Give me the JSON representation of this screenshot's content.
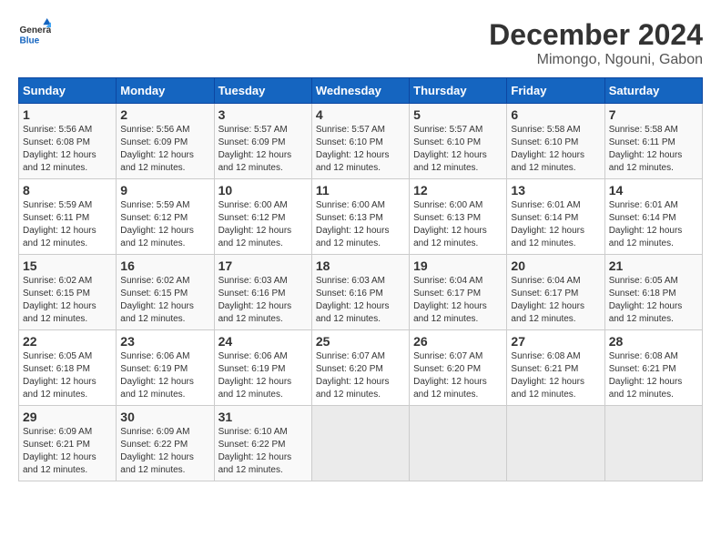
{
  "header": {
    "logo_line1": "General",
    "logo_line2": "Blue",
    "title": "December 2024",
    "subtitle": "Mimongo, Ngouni, Gabon"
  },
  "weekdays": [
    "Sunday",
    "Monday",
    "Tuesday",
    "Wednesday",
    "Thursday",
    "Friday",
    "Saturday"
  ],
  "weeks": [
    [
      {
        "day": "1",
        "info": "Sunrise: 5:56 AM\nSunset: 6:08 PM\nDaylight: 12 hours\nand 12 minutes."
      },
      {
        "day": "2",
        "info": "Sunrise: 5:56 AM\nSunset: 6:09 PM\nDaylight: 12 hours\nand 12 minutes."
      },
      {
        "day": "3",
        "info": "Sunrise: 5:57 AM\nSunset: 6:09 PM\nDaylight: 12 hours\nand 12 minutes."
      },
      {
        "day": "4",
        "info": "Sunrise: 5:57 AM\nSunset: 6:10 PM\nDaylight: 12 hours\nand 12 minutes."
      },
      {
        "day": "5",
        "info": "Sunrise: 5:57 AM\nSunset: 6:10 PM\nDaylight: 12 hours\nand 12 minutes."
      },
      {
        "day": "6",
        "info": "Sunrise: 5:58 AM\nSunset: 6:10 PM\nDaylight: 12 hours\nand 12 minutes."
      },
      {
        "day": "7",
        "info": "Sunrise: 5:58 AM\nSunset: 6:11 PM\nDaylight: 12 hours\nand 12 minutes."
      }
    ],
    [
      {
        "day": "8",
        "info": "Sunrise: 5:59 AM\nSunset: 6:11 PM\nDaylight: 12 hours\nand 12 minutes."
      },
      {
        "day": "9",
        "info": "Sunrise: 5:59 AM\nSunset: 6:12 PM\nDaylight: 12 hours\nand 12 minutes."
      },
      {
        "day": "10",
        "info": "Sunrise: 6:00 AM\nSunset: 6:12 PM\nDaylight: 12 hours\nand 12 minutes."
      },
      {
        "day": "11",
        "info": "Sunrise: 6:00 AM\nSunset: 6:13 PM\nDaylight: 12 hours\nand 12 minutes."
      },
      {
        "day": "12",
        "info": "Sunrise: 6:00 AM\nSunset: 6:13 PM\nDaylight: 12 hours\nand 12 minutes."
      },
      {
        "day": "13",
        "info": "Sunrise: 6:01 AM\nSunset: 6:14 PM\nDaylight: 12 hours\nand 12 minutes."
      },
      {
        "day": "14",
        "info": "Sunrise: 6:01 AM\nSunset: 6:14 PM\nDaylight: 12 hours\nand 12 minutes."
      }
    ],
    [
      {
        "day": "15",
        "info": "Sunrise: 6:02 AM\nSunset: 6:15 PM\nDaylight: 12 hours\nand 12 minutes."
      },
      {
        "day": "16",
        "info": "Sunrise: 6:02 AM\nSunset: 6:15 PM\nDaylight: 12 hours\nand 12 minutes."
      },
      {
        "day": "17",
        "info": "Sunrise: 6:03 AM\nSunset: 6:16 PM\nDaylight: 12 hours\nand 12 minutes."
      },
      {
        "day": "18",
        "info": "Sunrise: 6:03 AM\nSunset: 6:16 PM\nDaylight: 12 hours\nand 12 minutes."
      },
      {
        "day": "19",
        "info": "Sunrise: 6:04 AM\nSunset: 6:17 PM\nDaylight: 12 hours\nand 12 minutes."
      },
      {
        "day": "20",
        "info": "Sunrise: 6:04 AM\nSunset: 6:17 PM\nDaylight: 12 hours\nand 12 minutes."
      },
      {
        "day": "21",
        "info": "Sunrise: 6:05 AM\nSunset: 6:18 PM\nDaylight: 12 hours\nand 12 minutes."
      }
    ],
    [
      {
        "day": "22",
        "info": "Sunrise: 6:05 AM\nSunset: 6:18 PM\nDaylight: 12 hours\nand 12 minutes."
      },
      {
        "day": "23",
        "info": "Sunrise: 6:06 AM\nSunset: 6:19 PM\nDaylight: 12 hours\nand 12 minutes."
      },
      {
        "day": "24",
        "info": "Sunrise: 6:06 AM\nSunset: 6:19 PM\nDaylight: 12 hours\nand 12 minutes."
      },
      {
        "day": "25",
        "info": "Sunrise: 6:07 AM\nSunset: 6:20 PM\nDaylight: 12 hours\nand 12 minutes."
      },
      {
        "day": "26",
        "info": "Sunrise: 6:07 AM\nSunset: 6:20 PM\nDaylight: 12 hours\nand 12 minutes."
      },
      {
        "day": "27",
        "info": "Sunrise: 6:08 AM\nSunset: 6:21 PM\nDaylight: 12 hours\nand 12 minutes."
      },
      {
        "day": "28",
        "info": "Sunrise: 6:08 AM\nSunset: 6:21 PM\nDaylight: 12 hours\nand 12 minutes."
      }
    ],
    [
      {
        "day": "29",
        "info": "Sunrise: 6:09 AM\nSunset: 6:21 PM\nDaylight: 12 hours\nand 12 minutes."
      },
      {
        "day": "30",
        "info": "Sunrise: 6:09 AM\nSunset: 6:22 PM\nDaylight: 12 hours\nand 12 minutes."
      },
      {
        "day": "31",
        "info": "Sunrise: 6:10 AM\nSunset: 6:22 PM\nDaylight: 12 hours\nand 12 minutes."
      },
      null,
      null,
      null,
      null
    ]
  ]
}
